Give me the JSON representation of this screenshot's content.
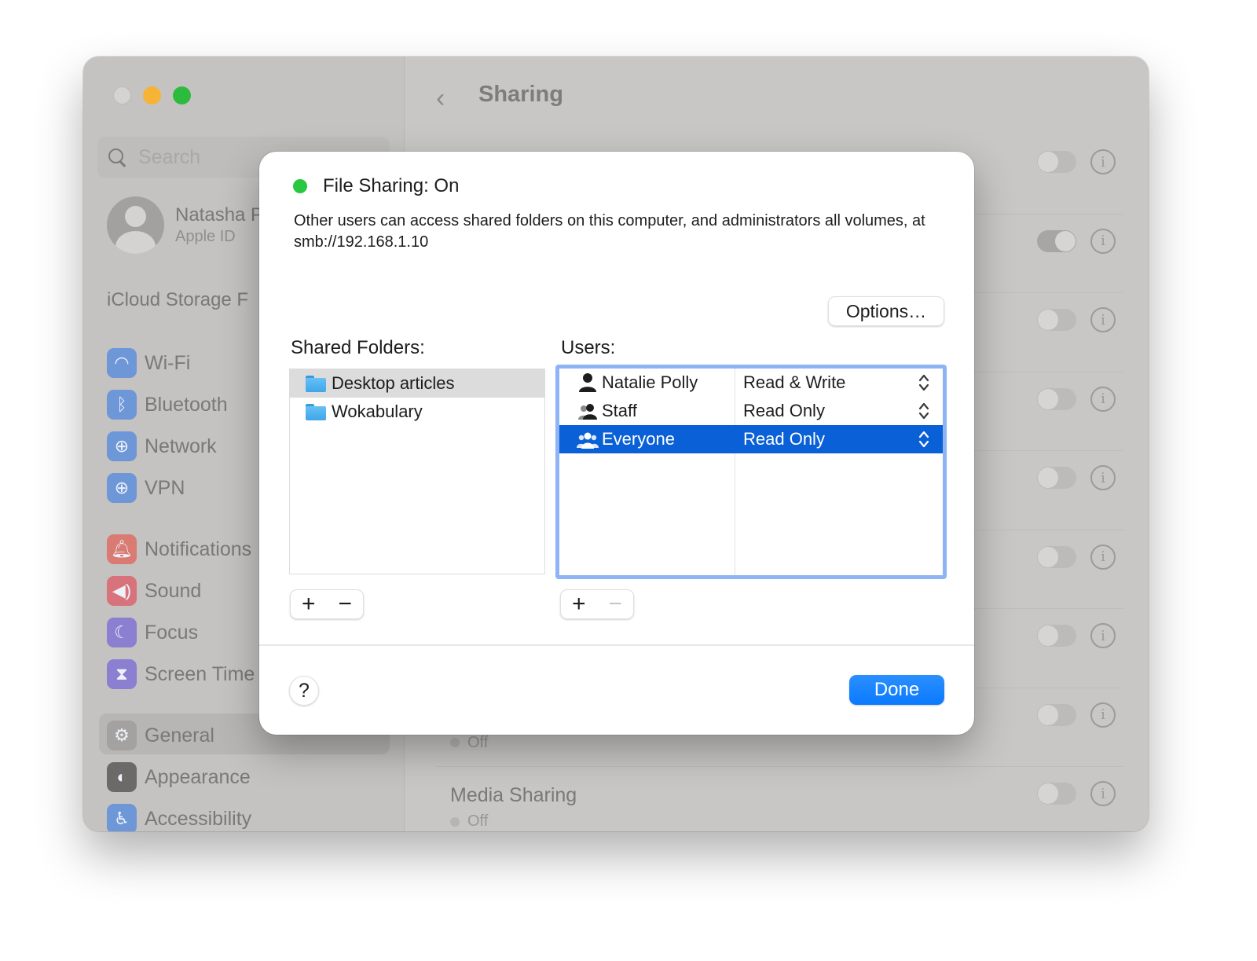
{
  "window": {
    "traffic_lights": [
      "close",
      "minimize",
      "maximize"
    ]
  },
  "sidebar": {
    "search_placeholder": "Search",
    "profile": {
      "name": "Natasha P",
      "subtitle": "Apple ID"
    },
    "icloud_label": "iCloud Storage F",
    "items": [
      {
        "label": "Wi-Fi",
        "icon": "wifi-icon",
        "color": "#6e97d8",
        "glyph": "◠"
      },
      {
        "label": "Bluetooth",
        "icon": "bluetooth-icon",
        "color": "#6e97d8",
        "glyph": "ᛒ"
      },
      {
        "label": "Network",
        "icon": "globe-icon",
        "color": "#6e97d8",
        "glyph": "⊕"
      },
      {
        "label": "VPN",
        "icon": "vpn-globe-icon",
        "color": "#6e97d8",
        "glyph": "⊕"
      },
      {
        "label": "Notifications",
        "icon": "bell-icon",
        "color": "#d97b73",
        "glyph": "🔔︎"
      },
      {
        "label": "Sound",
        "icon": "speaker-icon",
        "color": "#d8737c",
        "glyph": "◀)"
      },
      {
        "label": "Focus",
        "icon": "moon-icon",
        "color": "#8a7fd0",
        "glyph": "☾"
      },
      {
        "label": "Screen Time",
        "icon": "hourglass-icon",
        "color": "#8a7fd0",
        "glyph": "⧗"
      },
      {
        "label": "General",
        "icon": "gear-icon",
        "color": "#a3a2a1",
        "glyph": "⚙"
      },
      {
        "label": "Appearance",
        "icon": "appearance-icon",
        "color": "#6b6a69",
        "glyph": "◐"
      },
      {
        "label": "Accessibility",
        "icon": "accessibility-icon",
        "color": "#6e97d8",
        "glyph": "♿︎"
      }
    ]
  },
  "content": {
    "title": "Sharing",
    "back_glyph": "‹",
    "rows": [
      {
        "toggle_on": false
      },
      {
        "toggle_on": true
      },
      {
        "toggle_on": false
      },
      {
        "toggle_on": false
      },
      {
        "toggle_on": false
      },
      {
        "toggle_on": false
      },
      {
        "toggle_on": false
      },
      {
        "toggle_on": false,
        "status": "Off"
      },
      {
        "toggle_on": false,
        "label": "Media Sharing",
        "status": "Off"
      }
    ],
    "info_glyph": "i"
  },
  "dialog": {
    "status_label": "File Sharing: On",
    "status_color": "#28c840",
    "description": "Other users can access shared folders on this computer, and administrators all volumes, at smb://192.168.1.10",
    "options_button": "Options…",
    "shared_folders_label": "Shared Folders:",
    "folders": [
      {
        "name": "Desktop articles",
        "selected": true
      },
      {
        "name": "Wokabulary",
        "selected": false
      }
    ],
    "users_label": "Users:",
    "users": [
      {
        "name": "Natalie Polly",
        "permission": "Read & Write",
        "icon": "person-icon",
        "selected": false
      },
      {
        "name": "Staff",
        "permission": "Read Only",
        "icon": "group-icon",
        "selected": false
      },
      {
        "name": "Everyone",
        "permission": "Read Only",
        "icon": "everyone-icon",
        "selected": true
      }
    ],
    "add_glyph": "+",
    "remove_glyph": "−",
    "help_glyph": "?",
    "done_button": "Done",
    "accent_color": "#0a7aff",
    "selection_color": "#0a60d6"
  }
}
